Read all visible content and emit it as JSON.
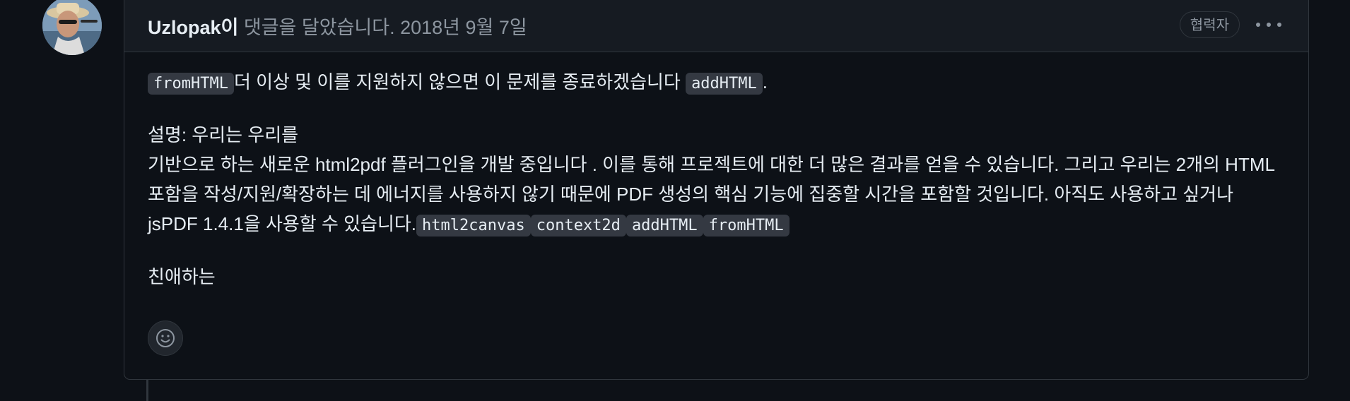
{
  "comment": {
    "author": "Uzlopak",
    "author_suffix": "이",
    "action": " 댓글을 달았습니다.",
    "timestamp": " 2018년 9월 7일",
    "role_badge": "협력자",
    "body": {
      "p1": {
        "code1": "fromHTML",
        "text1": "더 이상 및 이를 지원하지 않으면 이 문제를 종료하겠습니다 ",
        "code2": "addHTML",
        "text2": "."
      },
      "p2": {
        "line1": "설명: 우리는 우리를",
        "line2": "기반으로 하는 새로운 html2pdf 플러그인을 개발 중입니다 . 이를 통해 프로젝트에 대한 더 많은 결과를 얻을 수 있습니다. 그리고 우리는 2개의 HTML 포함을 작성/지원/확장하는 데 에너지를 사용하지 않기 때문에 PDF 생성의 핵심 기능에 집중할 시간을 포함할 것입니다. 아직도 사용하고 싶거나 jsPDF 1.4.1을 사용할 수 있습니다.",
        "codes": [
          "html2canvas",
          "context2d",
          "addHTML",
          "fromHTML"
        ]
      },
      "p3": "친애하는"
    }
  },
  "icons": {
    "avatar": "user-avatar-photo",
    "more": "kebab-horizontal-icon",
    "reaction": "smiley-icon"
  },
  "colors": {
    "background": "#0d1117",
    "header_background": "#161b22",
    "border": "#30363d",
    "text": "#e6edf3",
    "muted_text": "#8d96a0",
    "code_background": "#343942"
  }
}
